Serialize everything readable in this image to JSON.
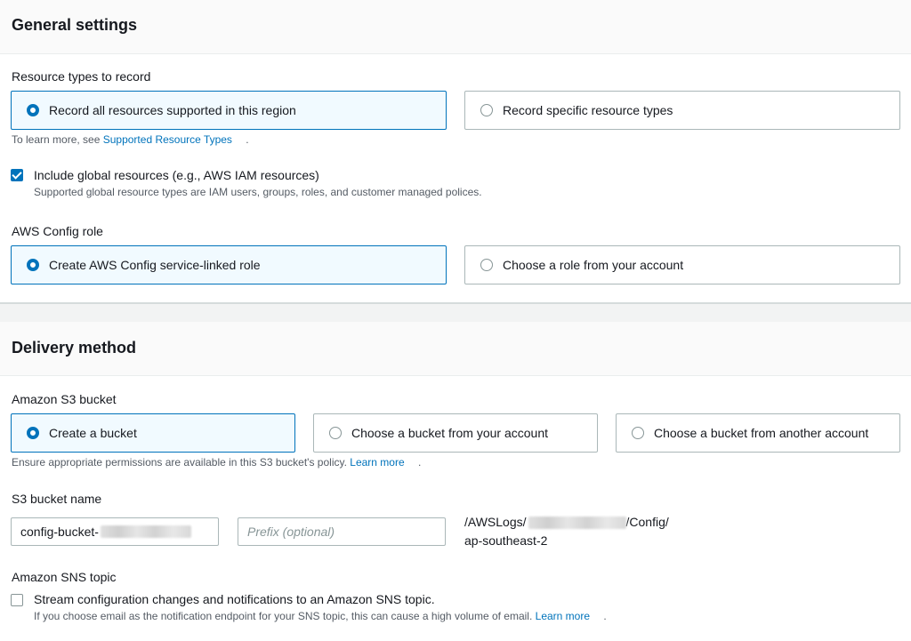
{
  "general": {
    "title": "General settings",
    "resource_types_label": "Resource types to record",
    "resource_options": [
      "Record all resources supported in this region",
      "Record specific resource types"
    ],
    "learn_more_prefix": "To learn more, see",
    "learn_more_link": "Supported Resource Types",
    "learn_more_suffix": ".",
    "include_global_label": "Include global resources (e.g., AWS IAM resources)",
    "include_global_hint": "Supported global resource types are IAM users, groups, roles, and customer managed polices.",
    "role_label": "AWS Config role",
    "role_options": [
      "Create AWS Config service-linked role",
      "Choose a role from your account"
    ]
  },
  "delivery": {
    "title": "Delivery method",
    "s3_label": "Amazon S3 bucket",
    "s3_options": [
      "Create a bucket",
      "Choose a bucket from your account",
      "Choose a bucket from another account"
    ],
    "s3_hint_prefix": "Ensure appropriate permissions are available in this S3 bucket's policy.",
    "s3_hint_link": "Learn more",
    "s3_hint_suffix": ".",
    "bucket_name_label": "S3 bucket name",
    "bucket_name_value": "config-bucket-",
    "prefix_placeholder": "Prefix (optional)",
    "path_part1": "/AWSLogs/",
    "path_part2": "/Config/",
    "path_part3": "ap-southeast-2",
    "sns_label": "Amazon SNS topic",
    "sns_checkbox_label": "Stream configuration changes and notifications to an Amazon SNS topic.",
    "sns_hint_prefix": "If you choose email as the notification endpoint for your SNS topic, this can cause a high volume of email.",
    "sns_hint_link": "Learn more",
    "sns_hint_suffix": "."
  },
  "colors": {
    "accent": "#0073bb",
    "selected_bg": "#f1faff",
    "border": "#aab7b8"
  }
}
